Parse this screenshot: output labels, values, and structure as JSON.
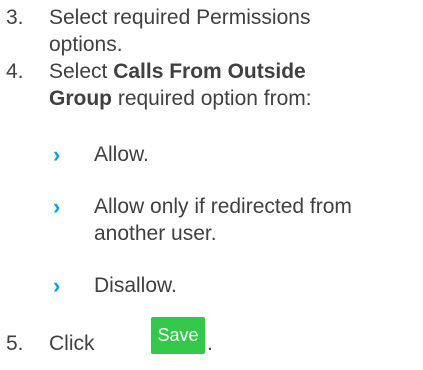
{
  "steps": [
    {
      "number": "3.",
      "line1": "Select required Permissions",
      "line2": "options."
    },
    {
      "number": "4.",
      "line1_pre": "Select ",
      "line1_bold": "Calls From Outside",
      "line2_bold": "Group",
      "line2_rest": " required option from:"
    },
    {
      "number": "5.",
      "pre": "Click",
      "post": "."
    }
  ],
  "options": [
    {
      "line1": "Allow."
    },
    {
      "line1": "Allow only if redirected from",
      "line2": "another user."
    },
    {
      "line1": "Disallow."
    }
  ],
  "bullet_icon": "chevron-right-icon",
  "save_button": {
    "label": "Save",
    "color": "#34c84a"
  },
  "colors": {
    "text": "#404040",
    "bullet": "#0e9ede"
  }
}
